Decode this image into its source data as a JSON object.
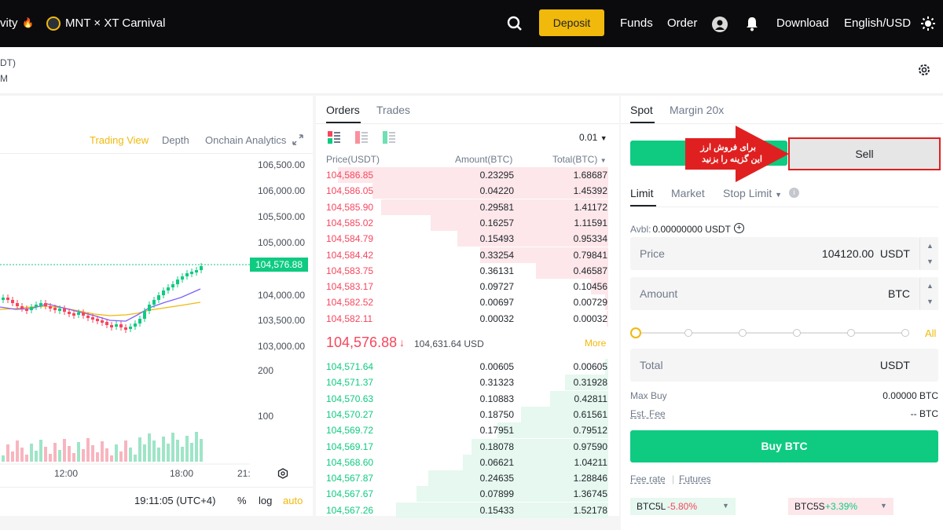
{
  "topbar": {
    "left_cut": "vity",
    "promo": "MNT × XT Carnival",
    "deposit": "Deposit",
    "funds": "Funds",
    "order": "Order",
    "download": "Download",
    "lang": "English/USD"
  },
  "symbol": {
    "line1": "DT)",
    "line2": "M"
  },
  "chart": {
    "tabs": [
      "Trading View",
      "Depth",
      "Onchain Analytics"
    ],
    "price_ticks": [
      "106,500.00",
      "106,000.00",
      "105,500.00",
      "105,000.00",
      "104,000.00",
      "103,500.00",
      "103,000.00"
    ],
    "current_price": "104,576.88",
    "volume_ticks": [
      "200",
      "100"
    ],
    "time_ticks": [
      "12:00",
      "18:00",
      "21:"
    ],
    "clock": "19:11:05 (UTC+4)",
    "pct": "%",
    "log": "log",
    "auto": "auto"
  },
  "orderbook": {
    "tabs": [
      "Orders",
      "Trades"
    ],
    "precision": "0.01",
    "headers": [
      "Price(USDT)",
      "Amount(BTC)",
      "Total(BTC)"
    ],
    "asks": [
      {
        "price": "104,586.85",
        "amount": "0.23295",
        "total": "1.68687",
        "depth": 0.93
      },
      {
        "price": "104,586.05",
        "amount": "0.04220",
        "total": "1.45392",
        "depth": 0.81
      },
      {
        "price": "104,585.90",
        "amount": "0.29581",
        "total": "1.41172",
        "depth": 0.78
      },
      {
        "price": "104,585.02",
        "amount": "0.16257",
        "total": "1.11591",
        "depth": 0.61
      },
      {
        "price": "104,584.79",
        "amount": "0.15493",
        "total": "0.95334",
        "depth": 0.52
      },
      {
        "price": "104,584.42",
        "amount": "0.33254",
        "total": "0.79841",
        "depth": 0.44
      },
      {
        "price": "104,583.75",
        "amount": "0.36131",
        "total": "0.46587",
        "depth": 0.25
      },
      {
        "price": "104,583.17",
        "amount": "0.09727",
        "total": "0.10456",
        "depth": 0.06
      },
      {
        "price": "104,582.52",
        "amount": "0.00697",
        "total": "0.00729",
        "depth": 0.01
      },
      {
        "price": "104,582.11",
        "amount": "0.00032",
        "total": "0.00032",
        "depth": 0.005
      }
    ],
    "last_price": "104,576.88",
    "last_usd": "104,631.64 USD",
    "more": "More",
    "bids": [
      {
        "price": "104,571.64",
        "amount": "0.00605",
        "total": "0.00605",
        "depth": 0.01
      },
      {
        "price": "104,571.37",
        "amount": "0.31323",
        "total": "0.31928",
        "depth": 0.15
      },
      {
        "price": "104,570.63",
        "amount": "0.10883",
        "total": "0.42811",
        "depth": 0.2
      },
      {
        "price": "104,570.27",
        "amount": "0.18750",
        "total": "0.61561",
        "depth": 0.3
      },
      {
        "price": "104,569.72",
        "amount": "0.17951",
        "total": "0.79512",
        "depth": 0.38
      },
      {
        "price": "104,569.17",
        "amount": "0.18078",
        "total": "0.97590",
        "depth": 0.47
      },
      {
        "price": "104,568.60",
        "amount": "0.06621",
        "total": "1.04211",
        "depth": 0.5
      },
      {
        "price": "104,567.87",
        "amount": "0.24635",
        "total": "1.28846",
        "depth": 0.62
      },
      {
        "price": "104,567.67",
        "amount": "0.07899",
        "total": "1.36745",
        "depth": 0.66
      },
      {
        "price": "104,567.26",
        "amount": "0.15433",
        "total": "1.52178",
        "depth": 0.73
      }
    ]
  },
  "trade": {
    "tabs": [
      "Spot",
      "Margin 20x"
    ],
    "sell": "Sell",
    "annotation_line1": "برای فروش ارز",
    "annotation_line2": "این گزینه را بزنید",
    "order_types": [
      "Limit",
      "Market",
      "Stop Limit"
    ],
    "avbl_label": "Avbl:",
    "avbl_value": "0.00000000 USDT",
    "price_label": "Price",
    "price_value": "104120.00",
    "price_unit": "USDT",
    "amount_label": "Amount",
    "amount_unit": "BTC",
    "all": "All",
    "total_label": "Total",
    "total_unit": "USDT",
    "max_buy_label": "Max Buy",
    "max_buy_value": "0.00000 BTC",
    "fee_label": "Est. Fee",
    "fee_value": "-- BTC",
    "buy": "Buy BTC",
    "fee_rate": "Fee rate",
    "futures": "Futures",
    "lev_long": "BTC5L",
    "lev_long_change": "-5.80%",
    "lev_short": "BTC5S",
    "lev_short_change": "+3.39%"
  },
  "colors": {
    "up": "#0ecb81",
    "down": "#f6465d",
    "accent": "#f0b90b",
    "annotation": "#e02020"
  }
}
